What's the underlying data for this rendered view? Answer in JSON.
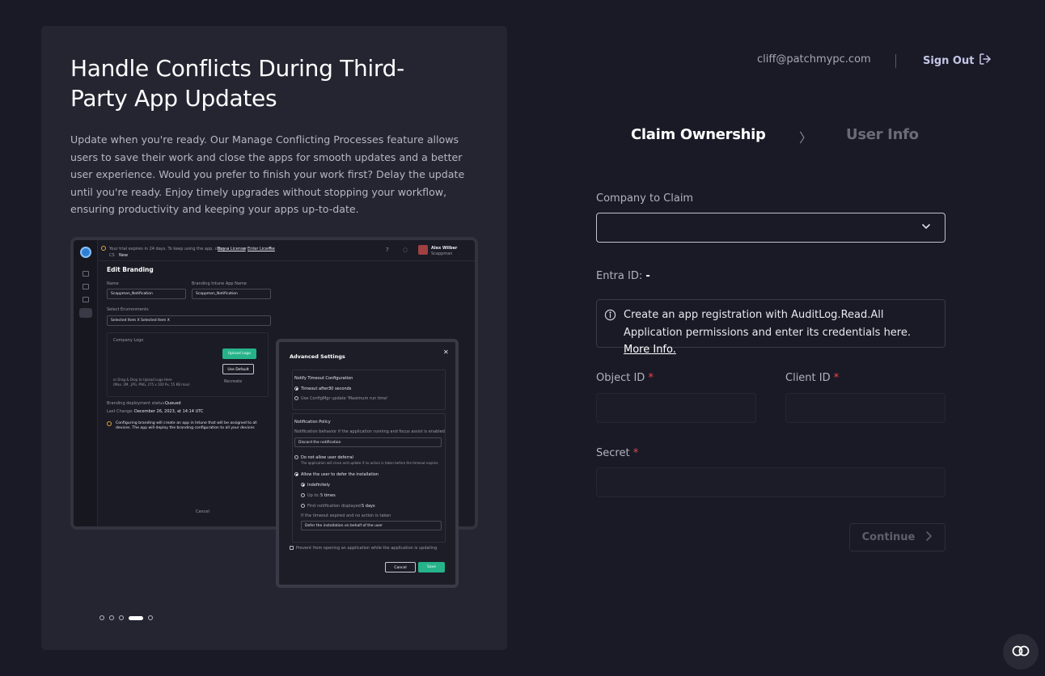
{
  "hero": {
    "title": "Handle Conflicts During Third-Party App Updates",
    "description": "Update when you're ready. Our Manage Conflicting Processes feature allows users to save their work and close the apps for smooth updates and a better user experience. Would you prefer to finish your work first? Delay the update until you're ready. Enjoy timely upgrades without stopping your workflow, ensuring productivity and keeping your apps up-to-date."
  },
  "mock": {
    "banner_prefix": "Your trial expires in 24 days. To keep using the app, choose",
    "banner_buy": "Buy a License",
    "banner_or": "or",
    "banner_enter": "Enter License",
    "crumb_prefix": "CS",
    "crumb_item": "New",
    "user_name": "Alex Wilber",
    "user_org": "Scappman",
    "page_title": "Edit Branding",
    "name_label": "Name",
    "name_value": "Scappman_Notification",
    "intune_label": "Branding Intune App Name",
    "intune_value": "Scappman_Notification",
    "env_label": "Select Environments",
    "env_value": "Selected Item X   Selected Item X",
    "logo_label": "Company Logo",
    "upload_btn": "Upload Logo",
    "default_btn": "Use Default",
    "recreate": "Recreate",
    "upload_hint1": "or Drag & Drop to Upload Logo Here",
    "upload_hint2": "(Max. 2M, .JPG, PNG, 275 x 100 Px, 55 KB max)",
    "status_label": "Branding deployment status:",
    "status_value": "Queued",
    "last_change_label": "Last Change:",
    "last_change_value": "December 26, 2023, at 14:14 UTC",
    "warning": "Configuring branding will create an app in Intune that will be assigned to all devices. The app will deploy the branding configuration to all your devices",
    "cancel": "Cancel"
  },
  "modal": {
    "title": "Advanced Settings",
    "timeout_title": "Notify Timeout Configuration",
    "timeout_after": "Timeout after:",
    "timeout_value": "30 seconds",
    "use_config": "Use ConfigMgr update 'Maximum run time'",
    "policy_title": "Notification Policy",
    "policy_desc": "Notification behavior if the application running and focus assist is enabled",
    "policy_value": "Discard the notification",
    "no_defer": "Do not allow user deferral",
    "no_defer_desc": "The application will close and update if no action is taken before the timeout expires",
    "allow_defer": "Allow the user to defer the installation",
    "indefinitely": "Indefinitely",
    "up_to": "Up to:",
    "up_to_value": "5 times",
    "first_notif": "First notification displayed:",
    "first_notif_value": "5 days",
    "timeout_expired": "If the timeout expired and no action is taken",
    "defer_value": "Defer the installation on behalf of the user",
    "prevent": "Prevent from opening an application while the application is updating",
    "cancel": "Cancel",
    "save": "Save"
  },
  "header": {
    "email": "cliff@patchmypc.com",
    "signout": "Sign Out"
  },
  "steps": {
    "step1": "Claim Ownership",
    "separator": "〉",
    "step2": "User Info"
  },
  "form": {
    "company_label": "Company to Claim",
    "company_value": "",
    "entra_label": "Entra ID:",
    "entra_value": "-",
    "info_text": "Create an app registration with AuditLog.Read.All Application permissions and enter its credentials here.",
    "info_link": "More Info.",
    "object_label": "Object ID",
    "client_label": "Client ID",
    "secret_label": "Secret",
    "required_mark": "*",
    "continue": "Continue"
  },
  "carousel": {
    "total": 5,
    "active_index": 3
  },
  "colors": {
    "background": "#1a1a27",
    "panel": "#252532",
    "accent_green": "#26b38a",
    "required": "#e5484d",
    "signout": "#c4c6e6"
  }
}
